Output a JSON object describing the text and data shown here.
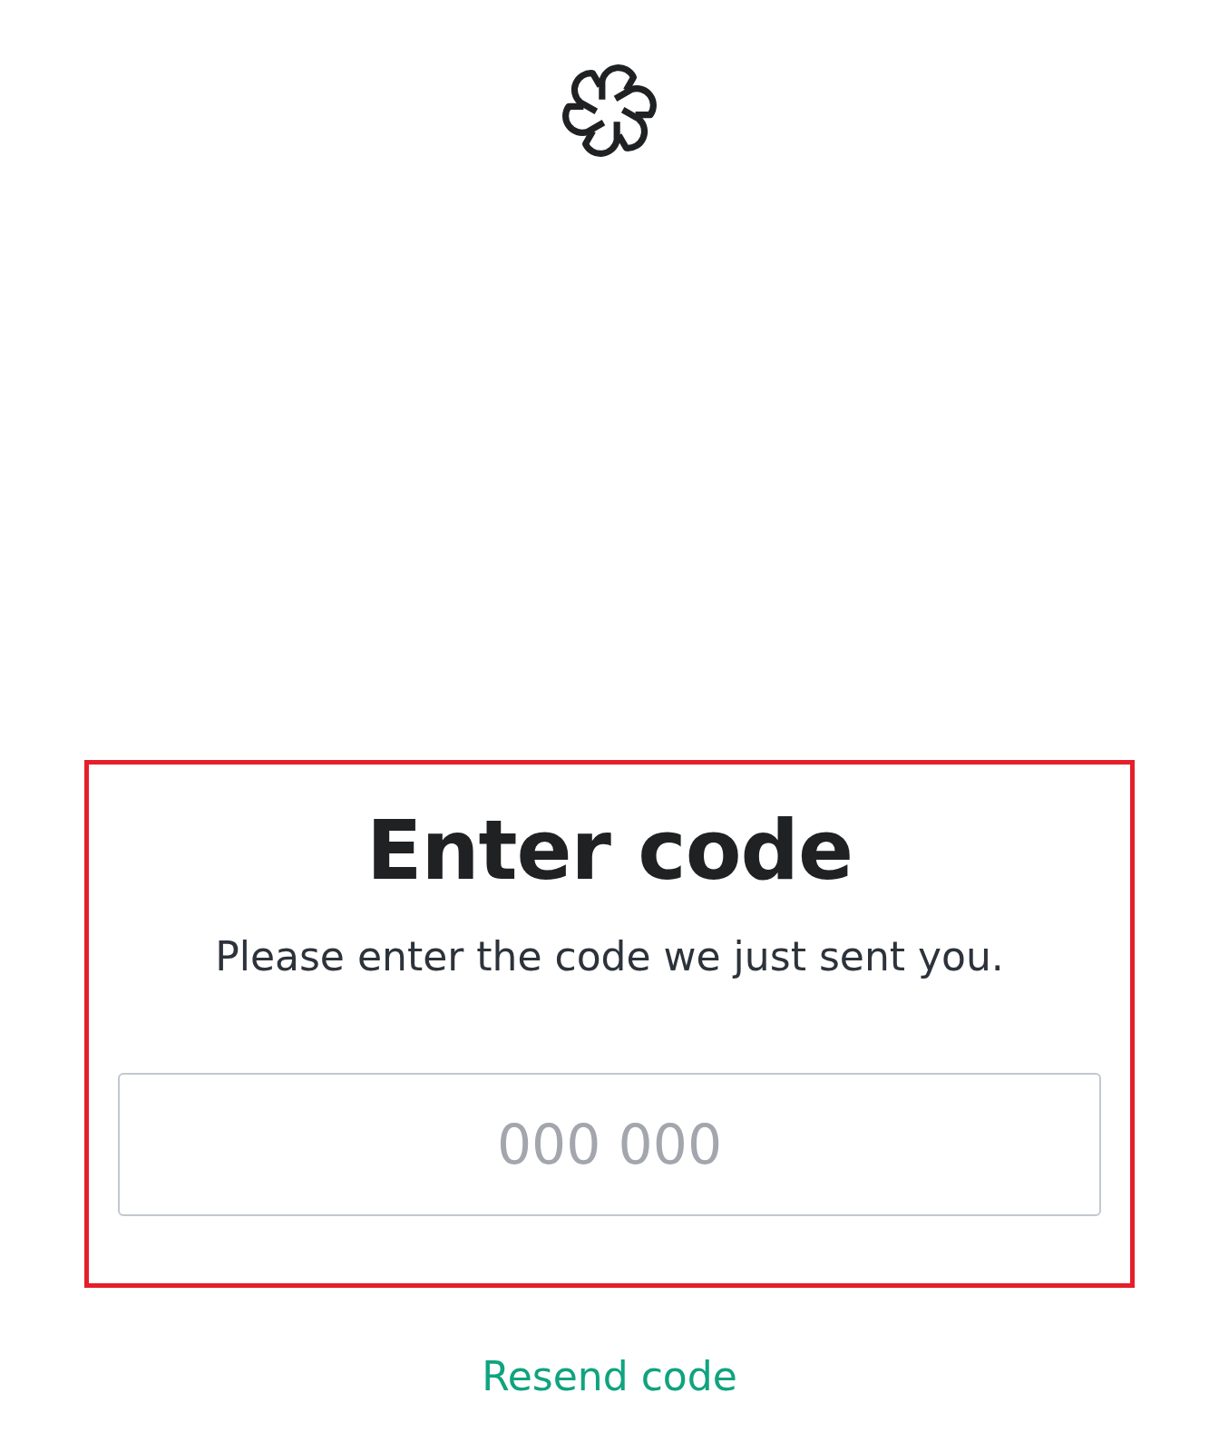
{
  "heading": "Enter code",
  "subtitle": "Please enter the code we just sent you.",
  "code_field": {
    "placeholder": "000 000"
  },
  "resend_link": "Resend code"
}
